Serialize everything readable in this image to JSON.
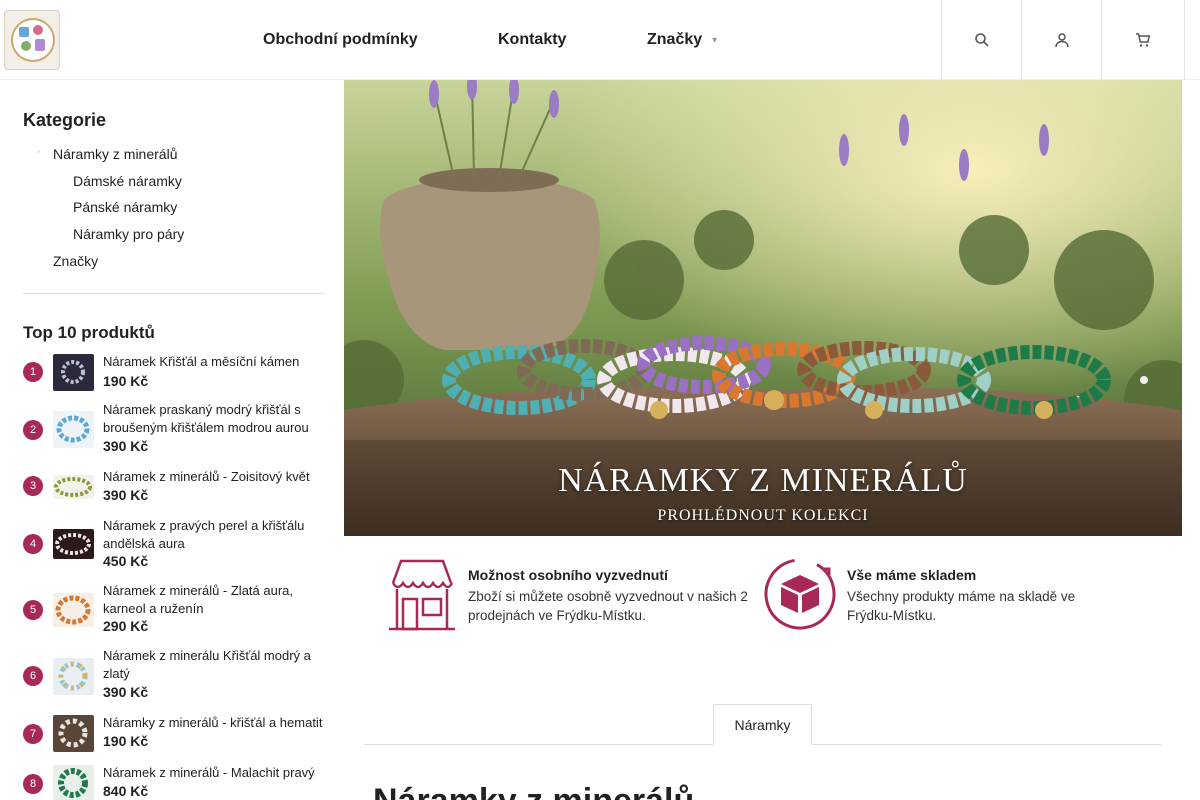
{
  "header": {
    "nav": [
      {
        "label": "Obchodní podmínky"
      },
      {
        "label": "Kontakty"
      },
      {
        "label": "Značky",
        "caret": "▾"
      }
    ],
    "icons": [
      "search-icon",
      "user-icon",
      "cart-icon"
    ]
  },
  "sidebar": {
    "categories_title": "Kategorie",
    "categories": [
      {
        "label": "Náramky z minerálů"
      },
      {
        "label": "Dámské náramky"
      },
      {
        "label": "Pánské náramky"
      },
      {
        "label": "Náramky pro páry"
      },
      {
        "label": "Značky"
      }
    ],
    "top_title": "Top 10 produktů",
    "top_products": [
      {
        "rank": "1",
        "name": "Náramek Křišťál a měsíční kámen",
        "price": "190 Kč"
      },
      {
        "rank": "2",
        "name": "Náramek praskaný modrý křišťál s broušeným křišťálem modrou aurou",
        "price": "390 Kč"
      },
      {
        "rank": "3",
        "name": "Náramek z minerálů - Zoisitový květ",
        "price": "390 Kč"
      },
      {
        "rank": "4",
        "name": "Náramek z pravých perel a křišťálu andělská aura",
        "price": "450 Kč"
      },
      {
        "rank": "5",
        "name": "Náramek z minerálů - Zlatá aura, karneol a ruženín",
        "price": "290 Kč"
      },
      {
        "rank": "6",
        "name": "Náramek z minerálu Křišťál modrý a zlatý",
        "price": "390 Kč"
      },
      {
        "rank": "7",
        "name": "Náramky z minerálů - křišťál a hematit",
        "price": "190 Kč"
      },
      {
        "rank": "8",
        "name": "Náramek z minerálů - Malachit pravý",
        "price": "840 Kč"
      }
    ]
  },
  "hero": {
    "title": "NÁRAMKY Z MINERÁLŮ",
    "subtitle": "PROHLÉDNOUT KOLEKCI"
  },
  "features": [
    {
      "icon": "store-icon",
      "title": "Možnost osobního vyzvednutí",
      "text": "Zboží si můžete osobně vyzvednout v našich 2 prodejnách ve Frýdku-Místku."
    },
    {
      "icon": "box-icon",
      "title": "Vše máme skladem",
      "text": "Všechny produkty máme na skladě ve Frýdku-Místku."
    }
  ],
  "tabs": [
    {
      "label": "Náramky"
    }
  ],
  "page_title": "Náramky z minerálů",
  "colors": {
    "accent": "#a8285a"
  }
}
